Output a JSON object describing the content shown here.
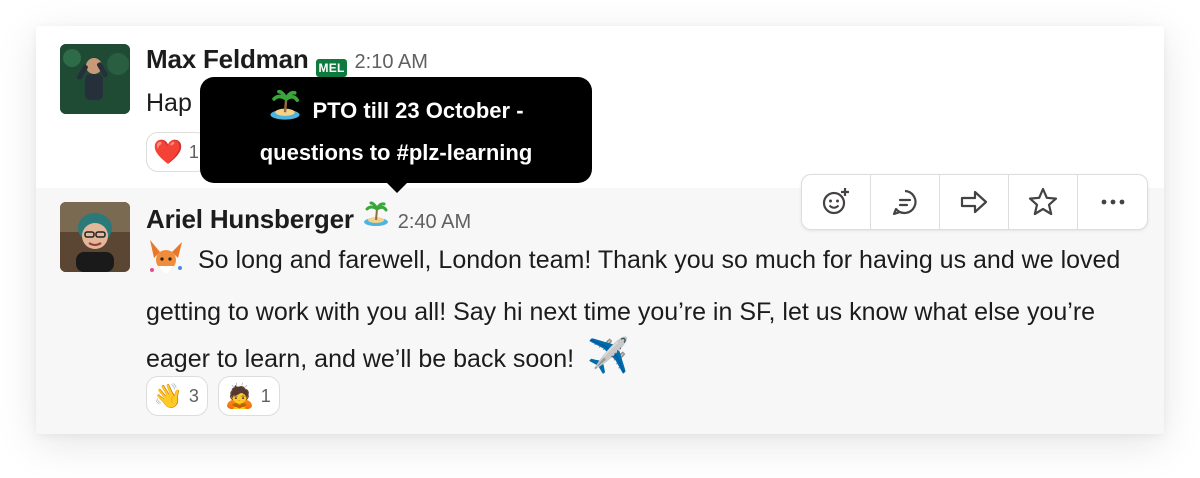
{
  "tooltip": {
    "line1": "PTO till 23 October -",
    "line2": "questions to #plz-learning",
    "icon": "island-icon"
  },
  "messages": [
    {
      "author": "Max Feldman",
      "badge_text": "MEL",
      "time": "2:10 AM",
      "text_visible": "Hap",
      "reactions": [
        {
          "emoji": "❤️",
          "count": "1"
        }
      ]
    },
    {
      "author": "Ariel Hunsberger",
      "status_icon": "island-icon",
      "time": "2:40 AM",
      "text": "So long and farewell, London team! Thank you so much for having us and we loved getting to work with you all! Say hi next time you’re in SF, let us know what else you’re eager to learn, and we’ll be back soon!",
      "leading_emoji": "fox-party-icon",
      "trailing_emoji": "✈️",
      "reactions": [
        {
          "emoji": "👋",
          "count": "3"
        },
        {
          "emoji": "🙇",
          "count": "1"
        }
      ]
    }
  ],
  "toolbar": [
    "add-reaction-icon",
    "reply-in-thread-icon",
    "share-message-icon",
    "save-star-icon",
    "more-actions-icon"
  ]
}
